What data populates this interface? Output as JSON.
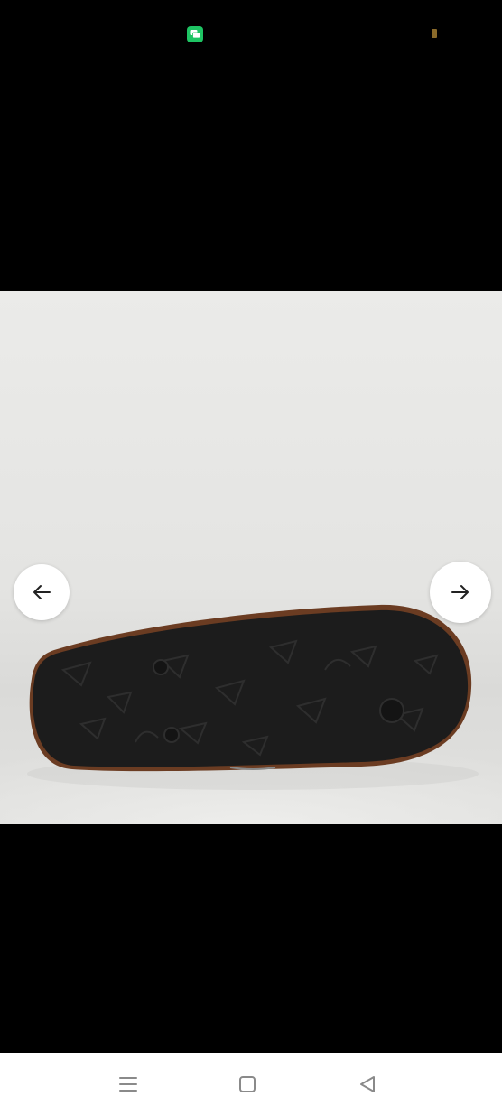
{
  "status_bar": {
    "left_icon": "chat-app-icon",
    "right_icon": "battery-icon",
    "colors": {
      "chat_icon": "#1ec463",
      "battery": "#8a6a2a"
    }
  },
  "image_viewer": {
    "content": "product-photo-sandal-sole",
    "prev_icon": "arrow-left-icon",
    "next_icon": "arrow-right-icon"
  },
  "system_nav": {
    "buttons": [
      "menu-icon",
      "home-icon",
      "back-icon"
    ]
  }
}
